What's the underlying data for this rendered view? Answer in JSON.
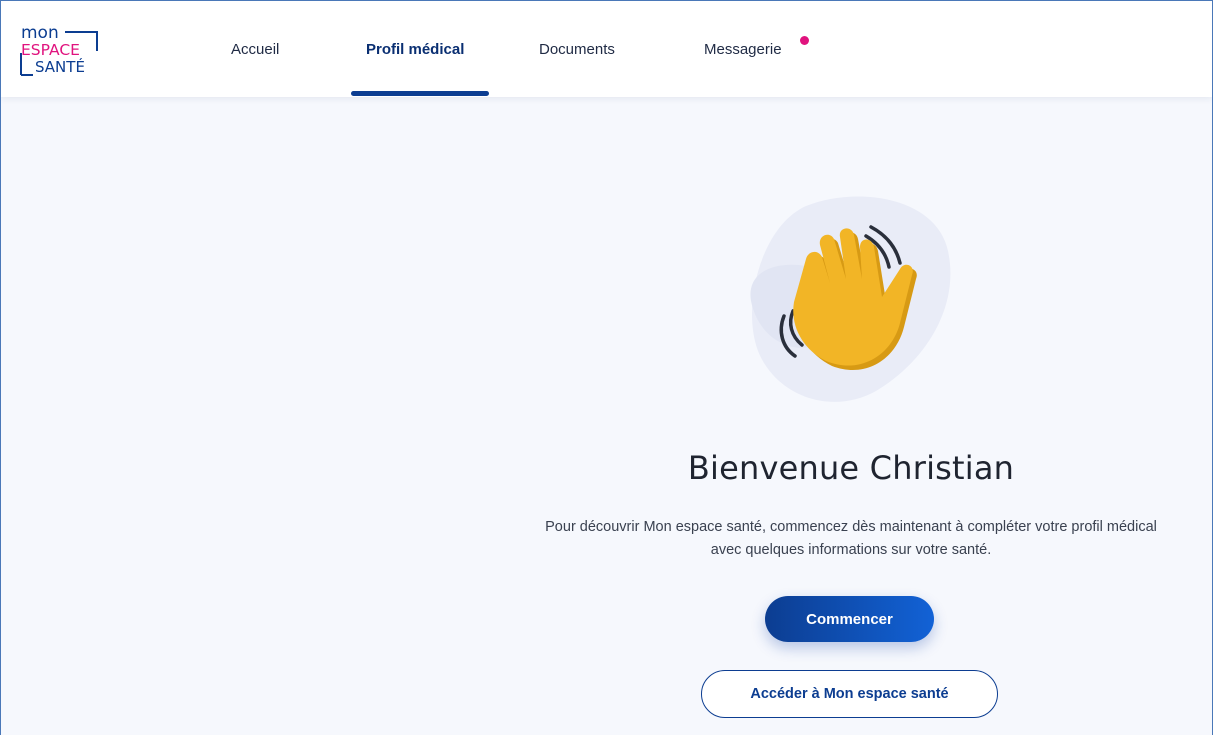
{
  "brand": {
    "logo_lines": [
      "mon",
      "ESPACE",
      "SANTÉ"
    ],
    "colors": {
      "navy": "#0c3d91",
      "pink": "#e0137e",
      "background": "#f6f8fd"
    }
  },
  "nav": {
    "items": [
      {
        "label": "Accueil",
        "active": false
      },
      {
        "label": "Profil médical",
        "active": true
      },
      {
        "label": "Documents",
        "active": false
      },
      {
        "label": "Messagerie",
        "active": false,
        "has_notification": true
      }
    ]
  },
  "welcome": {
    "illustration": "waving-hand-icon",
    "title": "Bienvenue Christian",
    "intro_line1": "Pour découvrir Mon espace santé, commencez dès maintenant à compléter votre profil médical",
    "intro_line2": "avec quelques informations sur votre santé.",
    "primary_button": "Commencer",
    "secondary_button": "Accéder à Mon espace santé"
  }
}
